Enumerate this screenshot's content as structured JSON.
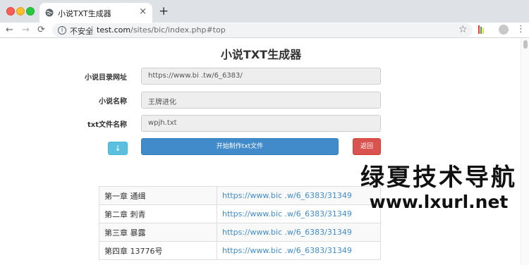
{
  "browser": {
    "tab": {
      "title": "小说TXT生成器",
      "close": "×"
    },
    "new_tab": "+",
    "nav": {
      "back": "←",
      "forward": "→",
      "reload": "⟳"
    },
    "omnibox": {
      "info": "i",
      "security": "不安全",
      "url_host": "test.com",
      "url_path": "/sites/bic",
      "url_mid": "",
      "url_tail": "/index.php#top"
    },
    "star": "☆",
    "menu": "⋮"
  },
  "page": {
    "title": "小说TXT生成器",
    "form": {
      "catalog_label": "小说目录网址",
      "catalog_value": "https://www.bi    .tw/6_6383/",
      "name_label": "小说名称",
      "name_value": "王牌进化",
      "file_label": "txt文件名称",
      "file_value": "wpjh.txt"
    },
    "buttons": {
      "download": "↓",
      "start": "开始制作txt文件",
      "back": "返回"
    },
    "chapters": [
      {
        "title": "第一章 通缉",
        "link": "https://www.bic      .w/6_6383/31349"
      },
      {
        "title": "第二章 刺青",
        "link": "https://www.bic      .w/6_6383/31349"
      },
      {
        "title": "第三章 暴露",
        "link": "https://www.bic      .w/6_6383/31349"
      },
      {
        "title": "第四章 13776号",
        "link": "https://www.bic      .w/6_6383/31349"
      }
    ]
  },
  "watermark": {
    "line1": "绿夏技术导航",
    "line2": "www.lxurl.net"
  }
}
